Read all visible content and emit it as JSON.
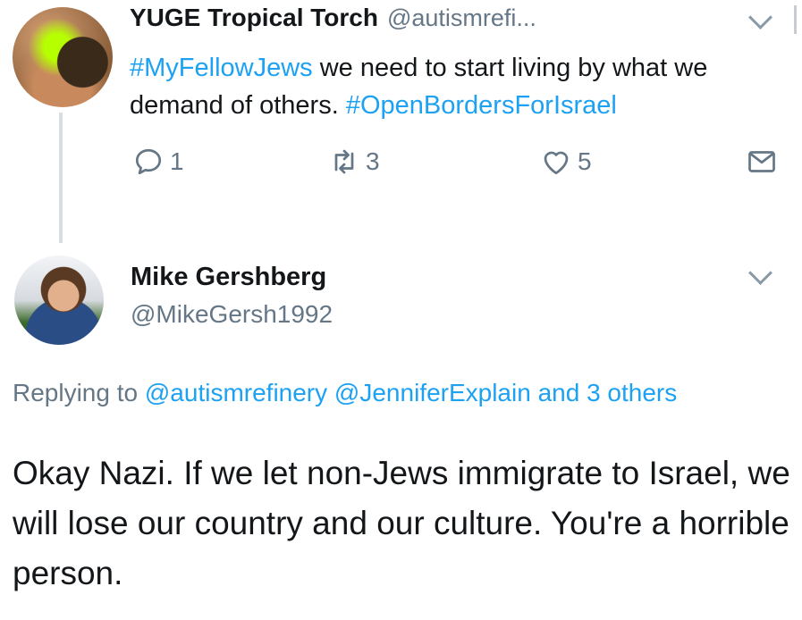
{
  "tweet1": {
    "display_name": "YUGE Tropical Torch",
    "handle": "@autismrefi...",
    "hashtag1": "#MyFellowJews",
    "text_part1": " we need to start living by what we demand of others. ",
    "hashtag2": "#OpenBordersForIsrael",
    "reply_count": "1",
    "retweet_count": "3",
    "like_count": "5"
  },
  "tweet2": {
    "display_name": "Mike Gershberg",
    "handle": "@MikeGersh1992",
    "replying_prefix": "Replying to ",
    "mention1": "@autismrefinery",
    "mention2": "@JenniferExplain",
    "others": "and 3 others",
    "body": "Okay Nazi. If we let non-Jews immigrate to Israel, we will lose our country and our culture. You're a horrible person."
  },
  "colors": {
    "link": "#1da1f2",
    "secondary_text": "#657786",
    "primary_text": "#14171a"
  },
  "icons": [
    "reply-icon",
    "retweet-icon",
    "like-icon",
    "direct-message-icon",
    "chevron-down-icon"
  ]
}
